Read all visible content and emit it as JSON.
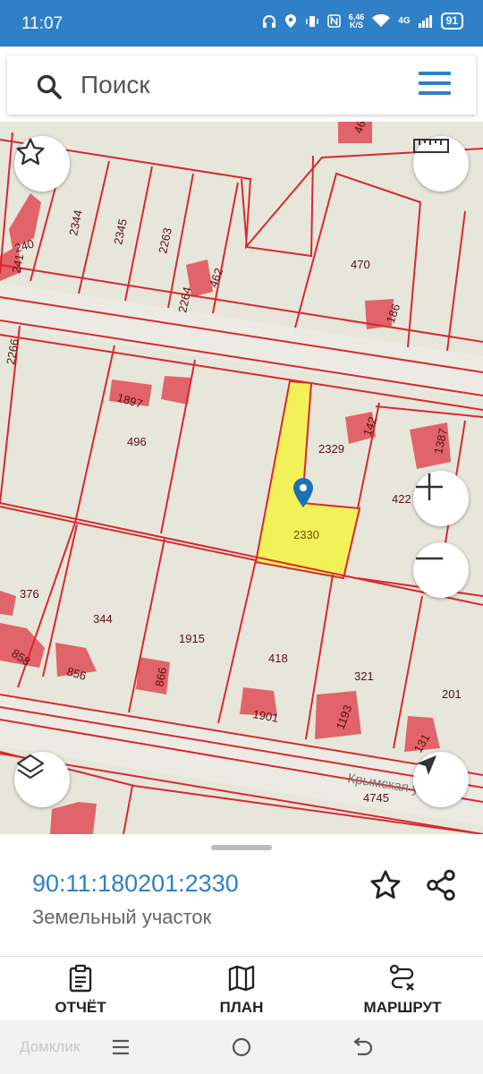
{
  "status_bar": {
    "time": "11:07",
    "net_speed_value": "6,46",
    "net_speed_unit": "K/S",
    "network": "4G",
    "battery": "91"
  },
  "search": {
    "placeholder": "Поиск"
  },
  "map": {
    "street_name": "Крымская улица",
    "highlighted_parcel": "2330",
    "parcel_labels": [
      "46",
      "2344",
      "2345",
      "2263",
      "240",
      "241",
      "470",
      "2264",
      "462",
      "186",
      "2266",
      "1897",
      "496",
      "142",
      "2329",
      "1387",
      "422",
      "376",
      "344",
      "1915",
      "858",
      "856",
      "866",
      "418",
      "321",
      "201",
      "1901",
      "1193",
      "131",
      "4745",
      "2330"
    ],
    "colors": {
      "background": "#e7e6da",
      "boundary": "#d9282f",
      "building": "#e0646a",
      "selected_fill": "#f3f341",
      "pin": "#1f6fb5"
    }
  },
  "object_card": {
    "cadastral_number": "90:11:180201:2330",
    "object_type": "Земельный участок"
  },
  "bottom_nav": {
    "report": "ОТЧЁТ",
    "plan": "ПЛАН",
    "route": "МАРШРУТ"
  },
  "watermark": "Домклик",
  "colors": {
    "accent": "#2f80c6"
  }
}
